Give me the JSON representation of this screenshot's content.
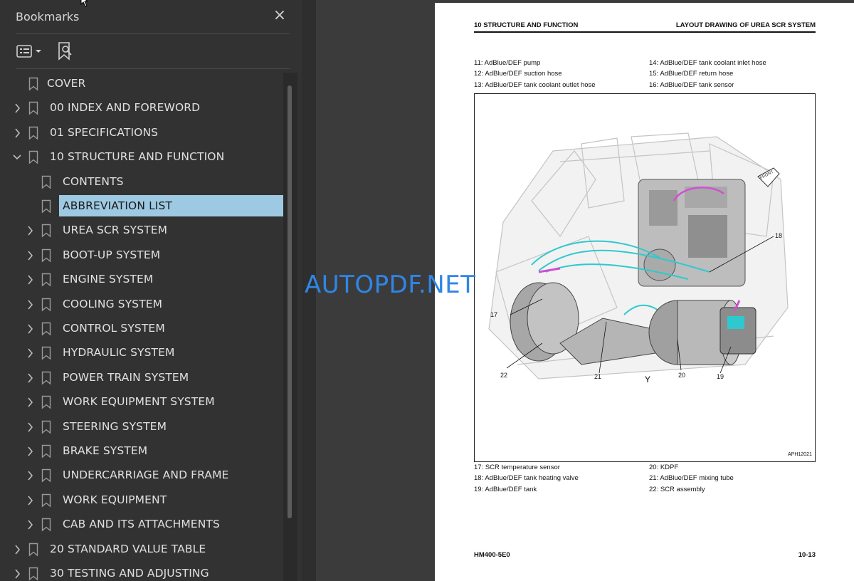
{
  "bookmarks_panel": {
    "title": "Bookmarks",
    "close_icon": "×",
    "items": [
      {
        "label": "COVER",
        "level": 0,
        "expander": "none",
        "selected": false
      },
      {
        "label": "00 INDEX AND FOREWORD",
        "level": 0,
        "expander": "collapsed",
        "selected": false
      },
      {
        "label": "01 SPECIFICATIONS",
        "level": 0,
        "expander": "collapsed",
        "selected": false
      },
      {
        "label": "10 STRUCTURE AND FUNCTION",
        "level": 0,
        "expander": "expanded",
        "selected": false
      },
      {
        "label": "CONTENTS",
        "level": 1,
        "expander": "none",
        "selected": false
      },
      {
        "label": "ABBREVIATION LIST",
        "level": 1,
        "expander": "none",
        "selected": true
      },
      {
        "label": "UREA SCR SYSTEM",
        "level": 1,
        "expander": "collapsed",
        "selected": false
      },
      {
        "label": "BOOT-UP SYSTEM",
        "level": 1,
        "expander": "collapsed",
        "selected": false
      },
      {
        "label": "ENGINE SYSTEM",
        "level": 1,
        "expander": "collapsed",
        "selected": false
      },
      {
        "label": "COOLING SYSTEM",
        "level": 1,
        "expander": "collapsed",
        "selected": false
      },
      {
        "label": "CONTROL SYSTEM",
        "level": 1,
        "expander": "collapsed",
        "selected": false
      },
      {
        "label": "HYDRAULIC SYSTEM",
        "level": 1,
        "expander": "collapsed",
        "selected": false
      },
      {
        "label": "POWER TRAIN SYSTEM",
        "level": 1,
        "expander": "collapsed",
        "selected": false
      },
      {
        "label": "WORK EQUIPMENT SYSTEM",
        "level": 1,
        "expander": "collapsed",
        "selected": false
      },
      {
        "label": "STEERING SYSTEM",
        "level": 1,
        "expander": "collapsed",
        "selected": false
      },
      {
        "label": "BRAKE SYSTEM",
        "level": 1,
        "expander": "collapsed",
        "selected": false
      },
      {
        "label": "UNDERCARRIAGE AND FRAME",
        "level": 1,
        "expander": "collapsed",
        "selected": false
      },
      {
        "label": "WORK EQUIPMENT",
        "level": 1,
        "expander": "collapsed",
        "selected": false
      },
      {
        "label": "CAB AND ITS ATTACHMENTS",
        "level": 1,
        "expander": "collapsed",
        "selected": false
      },
      {
        "label": "20 STANDARD VALUE TABLE",
        "level": 0,
        "expander": "collapsed",
        "selected": false
      },
      {
        "label": "30 TESTING AND ADJUSTING",
        "level": 0,
        "expander": "collapsed",
        "selected": false
      }
    ],
    "colors": {
      "selected_bg": "#9ec9e2",
      "panel_bg": "#323232",
      "text": "#e0e0e0"
    }
  },
  "document_page": {
    "header_left": "10 STRUCTURE AND FUNCTION",
    "header_right": "LAYOUT DRAWING OF UREA SCR SYSTEM",
    "legend_top": [
      "11: AdBlue/DEF pump",
      "14: AdBlue/DEF tank coolant inlet hose",
      "12: AdBlue/DEF suction hose",
      "15: AdBlue/DEF return hose",
      "13: AdBlue/DEF tank coolant outlet hose",
      "16: AdBlue/DEF tank sensor"
    ],
    "figure": {
      "callouts": [
        "17",
        "18",
        "19",
        "20",
        "21",
        "22"
      ],
      "view_label": "Y",
      "front_label": "FRONT",
      "figure_code": "APH12021"
    },
    "legend_bottom": [
      "17: SCR temperature sensor",
      "20: KDPF",
      "18: AdBlue/DEF tank heating valve",
      "21: AdBlue/DEF mixing tube",
      "19: AdBlue/DEF tank",
      "22: SCR assembly"
    ],
    "footer_left": "HM400-5E0",
    "footer_right": "10-13"
  },
  "watermark": "AUTOPDF.NET"
}
